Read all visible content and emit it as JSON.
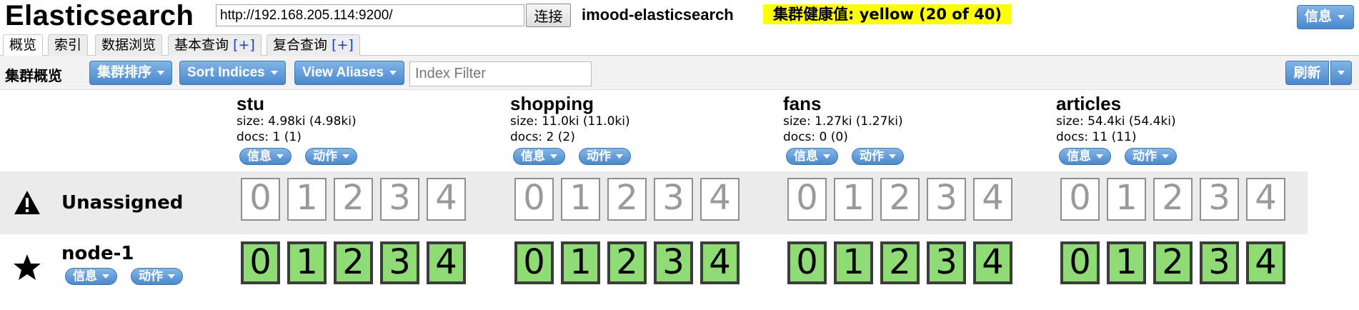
{
  "header": {
    "title": "Elasticsearch",
    "url": "http://192.168.205.114:9200/",
    "connect_label": "连接",
    "cluster_name": "imood-elasticsearch",
    "health": "集群健康值: yellow (20 of 40)",
    "info_menu": "信息",
    "health_color": "#ffff00"
  },
  "tabs": [
    {
      "label": "概览",
      "active": true
    },
    {
      "label": "索引"
    },
    {
      "label": "数据浏览"
    },
    {
      "label": "基本查询",
      "plus": "[+]"
    },
    {
      "label": "复合查询",
      "plus": "[+]"
    }
  ],
  "toolbar": {
    "title": "集群概览",
    "sort_cluster": "集群排序",
    "sort_indices": "Sort Indices",
    "view_aliases": "View Aliases",
    "index_filter_placeholder": "Index Filter",
    "refresh": "刷新"
  },
  "indices": [
    {
      "name": "stu",
      "size": "size: 4.98ki (4.98ki)",
      "docs": "docs: 1 (1)",
      "info": "信息",
      "action": "动作"
    },
    {
      "name": "shopping",
      "size": "size: 11.0ki (11.0ki)",
      "docs": "docs: 2 (2)",
      "info": "信息",
      "action": "动作"
    },
    {
      "name": "fans",
      "size": "size: 1.27ki (1.27ki)",
      "docs": "docs: 0 (0)",
      "info": "信息",
      "action": "动作"
    },
    {
      "name": "articles",
      "size": "size: 54.4ki (54.4ki)",
      "docs": "docs: 11 (11)",
      "info": "信息",
      "action": "动作"
    }
  ],
  "rows": {
    "unassigned": {
      "label": "Unassigned",
      "icon": "warning-icon"
    },
    "node": {
      "label": "node-1",
      "icon": "star-icon",
      "info": "信息",
      "action": "动作"
    }
  },
  "shards": [
    "0",
    "1",
    "2",
    "3",
    "4"
  ],
  "colors": {
    "accent_blue": "#4a89cf",
    "shard_started": "#8fdc76",
    "unassigned_bg": "#ebebeb"
  }
}
